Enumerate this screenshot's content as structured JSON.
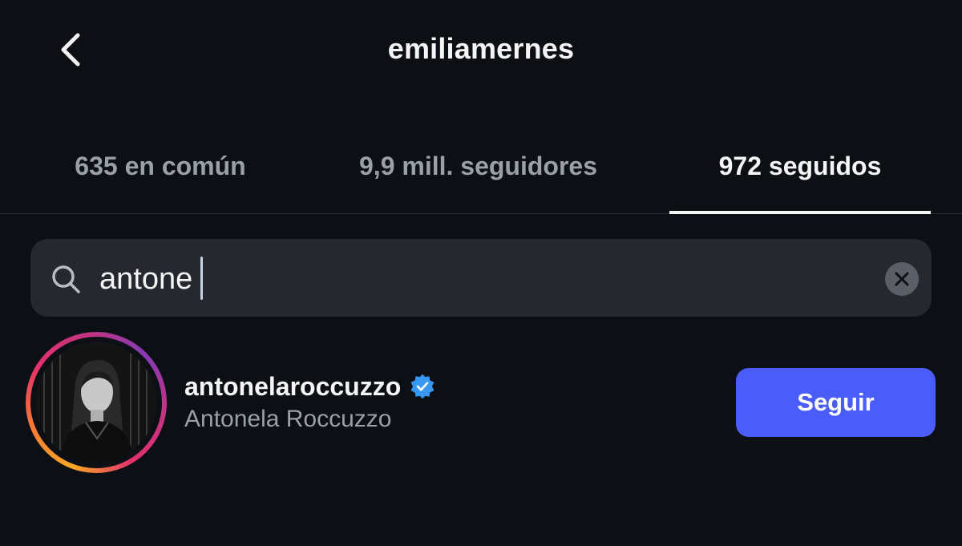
{
  "header": {
    "title": "emiliamernes",
    "back_icon": "chevron-left-icon"
  },
  "tabs": [
    {
      "label": "635 en común",
      "active": false
    },
    {
      "label": "9,9 mill. seguidores",
      "active": false
    },
    {
      "label": "972 seguidos",
      "active": true
    }
  ],
  "search": {
    "value": "antone",
    "icon": "search-icon",
    "clear_icon": "clear-icon"
  },
  "results": [
    {
      "username": "antonelaroccuzzo",
      "full_name": "Antonela Roccuzzo",
      "verified": true,
      "story_ring": true,
      "follow_label": "Seguir"
    }
  ],
  "colors": {
    "background": "#0c0f14",
    "search_bg": "#25282e",
    "follow_button": "#4a5df9",
    "verified_badge": "#3897f0",
    "muted_text": "#9aa0a8"
  }
}
